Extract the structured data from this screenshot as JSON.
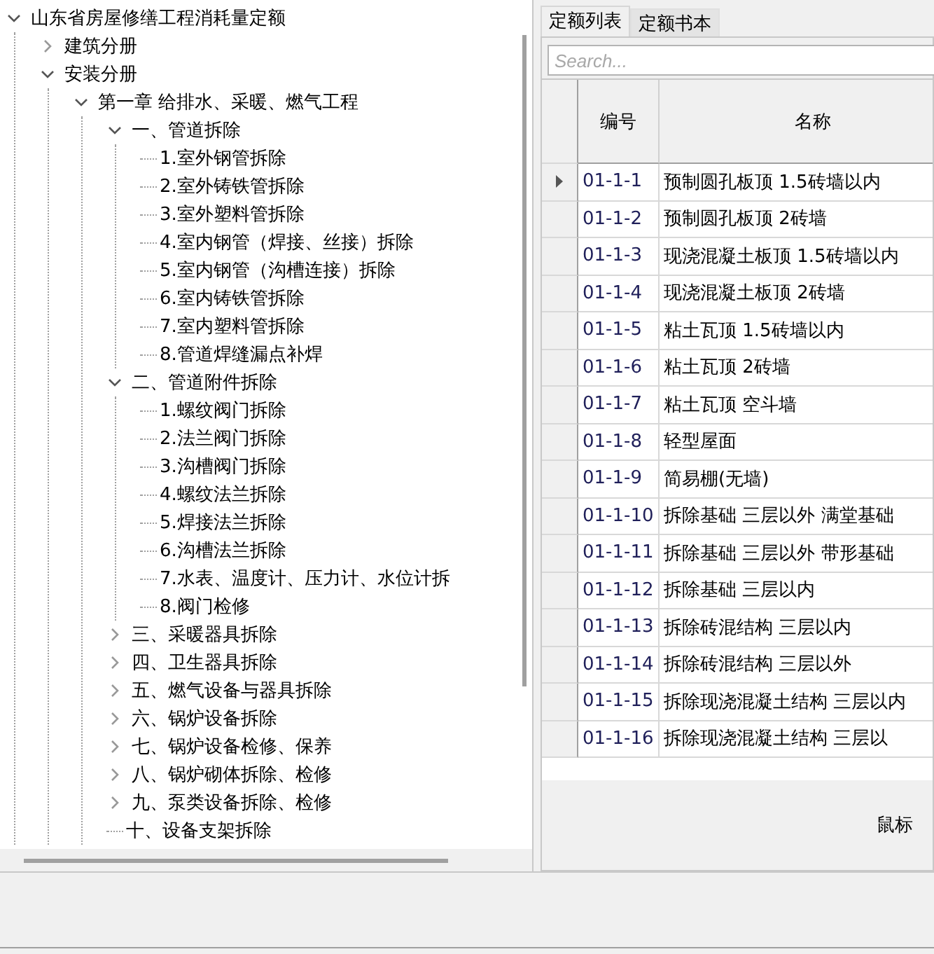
{
  "tree": [
    {
      "label": "山东省房屋修缮工程消耗量定额",
      "expanded": true,
      "children": [
        {
          "label": "建筑分册",
          "expanded": false
        },
        {
          "label": "安装分册",
          "expanded": true,
          "children": [
            {
              "label": "第一章 给排水、采暖、燃气工程",
              "expanded": true,
              "children": [
                {
                  "label": "一、管道拆除",
                  "expanded": true,
                  "children": [
                    {
                      "label": "1.室外钢管拆除"
                    },
                    {
                      "label": "2.室外铸铁管拆除"
                    },
                    {
                      "label": "3.室外塑料管拆除"
                    },
                    {
                      "label": "4.室内钢管（焊接、丝接）拆除"
                    },
                    {
                      "label": "5.室内钢管（沟槽连接）拆除"
                    },
                    {
                      "label": "6.室内铸铁管拆除"
                    },
                    {
                      "label": "7.室内塑料管拆除"
                    },
                    {
                      "label": "8.管道焊缝漏点补焊"
                    }
                  ]
                },
                {
                  "label": "二、管道附件拆除",
                  "expanded": true,
                  "children": [
                    {
                      "label": "1.螺纹阀门拆除"
                    },
                    {
                      "label": "2.法兰阀门拆除"
                    },
                    {
                      "label": "3.沟槽阀门拆除"
                    },
                    {
                      "label": "4.螺纹法兰拆除"
                    },
                    {
                      "label": "5.焊接法兰拆除"
                    },
                    {
                      "label": "6.沟槽法兰拆除"
                    },
                    {
                      "label": "7.水表、温度计、压力计、水位计拆"
                    },
                    {
                      "label": "8.阀门检修"
                    }
                  ]
                },
                {
                  "label": "三、采暖器具拆除",
                  "expanded": false
                },
                {
                  "label": "四、卫生器具拆除",
                  "expanded": false
                },
                {
                  "label": "五、燃气设备与器具拆除",
                  "expanded": false
                },
                {
                  "label": "六、锅炉设备拆除",
                  "expanded": false
                },
                {
                  "label": "七、锅炉设备检修、保养",
                  "expanded": false
                },
                {
                  "label": "八、锅炉砌体拆除、检修",
                  "expanded": false
                },
                {
                  "label": "九、泵类设备拆除、检修",
                  "expanded": false
                },
                {
                  "label": "十、设备支架拆除"
                }
              ]
            }
          ]
        }
      ]
    }
  ],
  "tabs": [
    {
      "label": "定额列表",
      "selected": true
    },
    {
      "label": "定额书本",
      "selected": false
    }
  ],
  "search": {
    "placeholder": "Search..."
  },
  "table": {
    "columns": [
      "编号",
      "名称"
    ],
    "rows": [
      {
        "selected": true,
        "cells": [
          "01-1-1",
          "预制圆孔板顶 1.5砖墙以内"
        ]
      },
      {
        "selected": false,
        "cells": [
          "01-1-2",
          "预制圆孔板顶 2砖墙"
        ]
      },
      {
        "selected": false,
        "cells": [
          "01-1-3",
          "现浇混凝土板顶 1.5砖墙以内"
        ]
      },
      {
        "selected": false,
        "cells": [
          "01-1-4",
          "现浇混凝土板顶 2砖墙"
        ]
      },
      {
        "selected": false,
        "cells": [
          "01-1-5",
          "粘土瓦顶 1.5砖墙以内"
        ]
      },
      {
        "selected": false,
        "cells": [
          "01-1-6",
          "粘土瓦顶 2砖墙"
        ]
      },
      {
        "selected": false,
        "cells": [
          "01-1-7",
          "粘土瓦顶 空斗墙"
        ]
      },
      {
        "selected": false,
        "cells": [
          "01-1-8",
          "轻型屋面"
        ]
      },
      {
        "selected": false,
        "cells": [
          "01-1-9",
          "简易棚(无墙)"
        ]
      },
      {
        "selected": false,
        "cells": [
          "01-1-10",
          "拆除基础 三层以外 满堂基础"
        ]
      },
      {
        "selected": false,
        "cells": [
          "01-1-11",
          "拆除基础 三层以外 带形基础"
        ]
      },
      {
        "selected": false,
        "cells": [
          "01-1-12",
          "拆除基础 三层以内"
        ]
      },
      {
        "selected": false,
        "cells": [
          "01-1-13",
          "拆除砖混结构 三层以内"
        ]
      },
      {
        "selected": false,
        "cells": [
          "01-1-14",
          "拆除砖混结构 三层以外"
        ]
      },
      {
        "selected": false,
        "cells": [
          "01-1-15",
          "拆除现浇混凝土结构 三层以内"
        ]
      },
      {
        "selected": false,
        "cells": [
          "01-1-16",
          "拆除现浇混凝土结构 三层以"
        ]
      }
    ]
  },
  "hint": "鼠标"
}
